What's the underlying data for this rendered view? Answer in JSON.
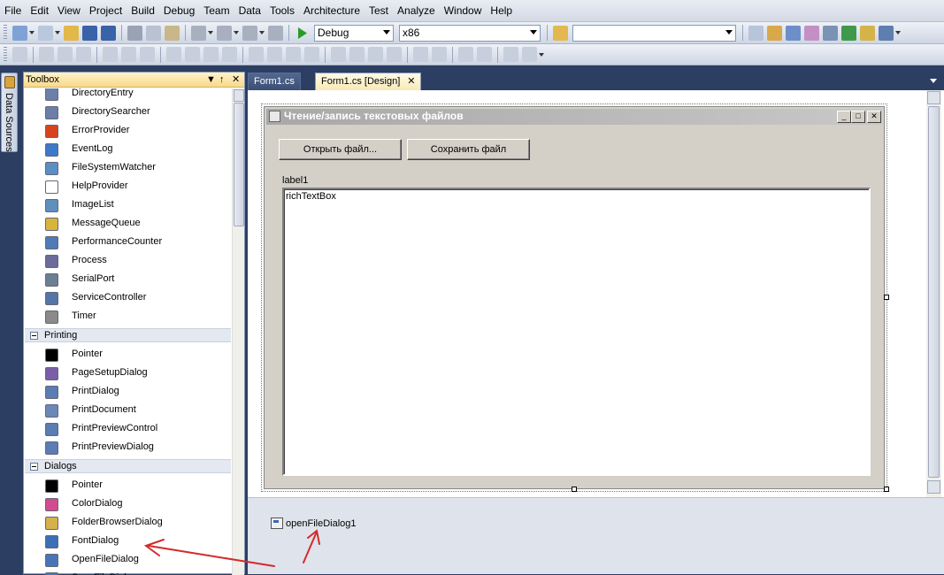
{
  "menu": [
    "File",
    "Edit",
    "View",
    "Project",
    "Build",
    "Debug",
    "Team",
    "Data",
    "Tools",
    "Architecture",
    "Test",
    "Analyze",
    "Window",
    "Help"
  ],
  "toolbar": {
    "config_value": "Debug",
    "platform_value": "x86",
    "find_value": ""
  },
  "side_tab": {
    "label": "Data Sources"
  },
  "toolbox": {
    "title": "Toolbox",
    "pin": "↑",
    "close": "✕",
    "items_components": [
      {
        "label": "DirectoryEntry",
        "icon": "directory-entry-icon",
        "color": "#6b7fa8"
      },
      {
        "label": "DirectorySearcher",
        "icon": "directory-searcher-icon",
        "color": "#6b7fa8"
      },
      {
        "label": "ErrorProvider",
        "icon": "error-provider-icon",
        "color": "#d8431f"
      },
      {
        "label": "EventLog",
        "icon": "event-log-icon",
        "color": "#3d79c9"
      },
      {
        "label": "FileSystemWatcher",
        "icon": "file-system-watcher-icon",
        "color": "#5a8fc4"
      },
      {
        "label": "HelpProvider",
        "icon": "help-provider-icon",
        "color": "#ffffff"
      },
      {
        "label": "ImageList",
        "icon": "image-list-icon",
        "color": "#5f8fbd"
      },
      {
        "label": "MessageQueue",
        "icon": "message-queue-icon",
        "color": "#d9b43a"
      },
      {
        "label": "PerformanceCounter",
        "icon": "performance-counter-icon",
        "color": "#4f7bb8"
      },
      {
        "label": "Process",
        "icon": "process-icon",
        "color": "#6b6b9c"
      },
      {
        "label": "SerialPort",
        "icon": "serial-port-icon",
        "color": "#6a7f93"
      },
      {
        "label": "ServiceController",
        "icon": "service-controller-icon",
        "color": "#5276a8"
      },
      {
        "label": "Timer",
        "icon": "timer-icon",
        "color": "#8a8a8a"
      }
    ],
    "cat_printing": "Printing",
    "items_printing": [
      {
        "label": "Pointer",
        "icon": "pointer-icon",
        "color": "#000000"
      },
      {
        "label": "PageSetupDialog",
        "icon": "page-setup-dialog-icon",
        "color": "#7b5ea8"
      },
      {
        "label": "PrintDialog",
        "icon": "print-dialog-icon",
        "color": "#5b7cb4"
      },
      {
        "label": "PrintDocument",
        "icon": "print-document-icon",
        "color": "#6b88b8"
      },
      {
        "label": "PrintPreviewControl",
        "icon": "print-preview-control-icon",
        "color": "#5b7cb4"
      },
      {
        "label": "PrintPreviewDialog",
        "icon": "print-preview-dialog-icon",
        "color": "#5b7cb4"
      }
    ],
    "cat_dialogs": "Dialogs",
    "items_dialogs": [
      {
        "label": "Pointer",
        "icon": "pointer-icon",
        "color": "#000000"
      },
      {
        "label": "ColorDialog",
        "icon": "color-dialog-icon",
        "color": "#d14b8f"
      },
      {
        "label": "FolderBrowserDialog",
        "icon": "folder-browser-dialog-icon",
        "color": "#d7b04a"
      },
      {
        "label": "FontDialog",
        "icon": "font-dialog-icon",
        "color": "#3c6fb5"
      },
      {
        "label": "OpenFileDialog",
        "icon": "open-file-dialog-icon",
        "color": "#4a74b8"
      },
      {
        "label": "SaveFileDialog",
        "icon": "save-file-dialog-icon",
        "color": "#4a74b8"
      }
    ]
  },
  "tabs": [
    {
      "label": "Form1.cs",
      "active": false
    },
    {
      "label": "Form1.cs [Design]",
      "active": true
    }
  ],
  "tab_close": "✕",
  "form": {
    "title": "Чтение/запись текстовых файлов",
    "open_button": "Открыть файл...",
    "save_button": "Сохранить файл",
    "label": "label1",
    "richtext": "richTextBox"
  },
  "tray": {
    "component": "openFileDialog1"
  },
  "colors": {
    "annotation_arrow": "#d42a2a"
  }
}
